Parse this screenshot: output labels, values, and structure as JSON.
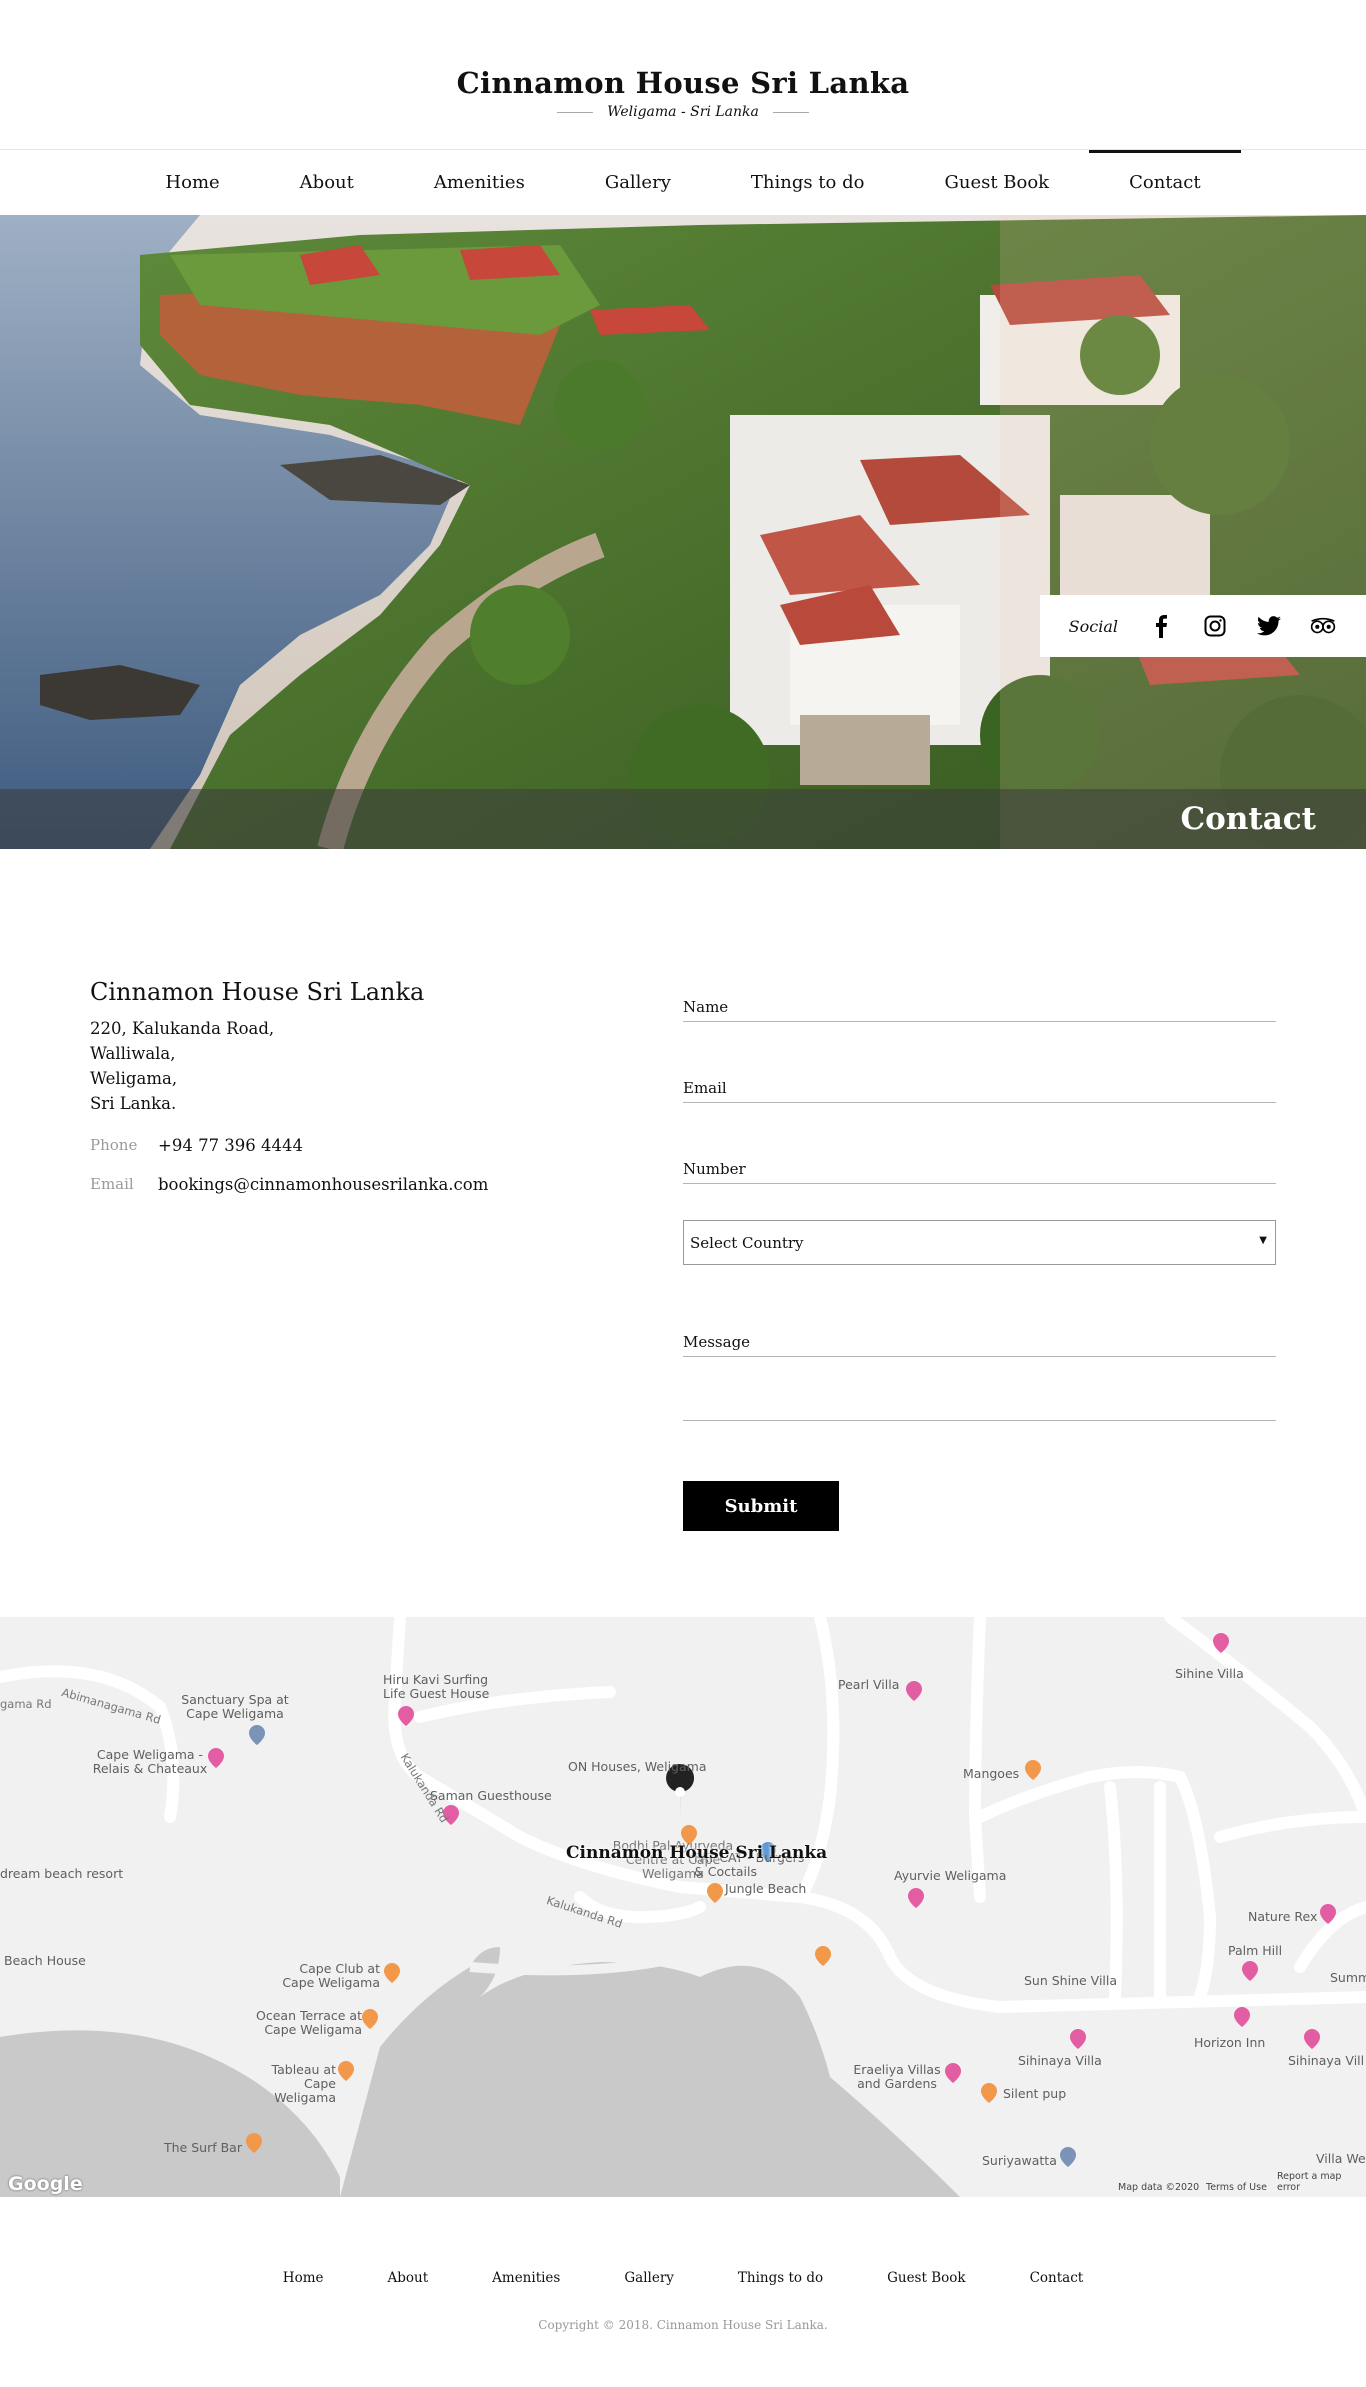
{
  "header": {
    "brand": "Cinnamon House Sri Lanka",
    "tagline": "Weligama - Sri Lanka"
  },
  "nav": {
    "items": [
      {
        "label": "Home"
      },
      {
        "label": "About"
      },
      {
        "label": "Amenities"
      },
      {
        "label": "Gallery"
      },
      {
        "label": "Things to do"
      },
      {
        "label": "Guest Book"
      },
      {
        "label": "Contact"
      }
    ],
    "active": "Contact"
  },
  "hero": {
    "title": "Contact",
    "social_label": "Social",
    "social_icons": [
      "facebook-icon",
      "instagram-icon",
      "twitter-icon",
      "tripadvisor-icon"
    ]
  },
  "address": {
    "name": "Cinnamon House Sri Lanka",
    "lines": [
      "220, Kalukanda Road,",
      "Walliwala,",
      "Weligama,",
      "Sri Lanka."
    ],
    "phone_label": "Phone",
    "phone": "+94 77 396 4444",
    "email_label": "Email",
    "email": "bookings@cinnamonhousesrilanka.com"
  },
  "form": {
    "name_label": "Name",
    "email_label": "Email",
    "number_label": "Number",
    "country_selected": "Select Country",
    "message_label": "Message",
    "submit_label": "Submit"
  },
  "map": {
    "title": "Cinnamon House Sri Lanka",
    "places": [
      "Sihine Villa",
      "Pearl Villa",
      "Hiru Kavi Surfing Life Guest House",
      "Sanctuary Spa at Cape Weligama",
      "Cape Weligama - Relais & Chateaux",
      "ON Houses, Weligama",
      "Saman Guesthouse",
      "Mangoes",
      "Bodhi Pal Ayurveda Centre at Cape Weligama",
      "FAT CAT - Burgers & Coctails",
      "Jungle Beach",
      "Ayurvie Weligama",
      "Nature Rex",
      "Palm Hill",
      "Sun Shine Villa",
      "Summ",
      "Horizon Inn",
      "Sihinaya Villa",
      "Sihinaya Vill",
      "Eraeliya Villas and Gardens",
      "Silent pup",
      "Suriyawatta",
      "Villa We",
      "Cape Club at Cape Weligama",
      "Ocean Terrace at Cape Weligama",
      "Tableau at Cape Weligama",
      "The Surf Bar",
      "dream beach resort",
      "Beach House"
    ],
    "roads": [
      "Kalukanda Rd",
      "Abimanagama Rd",
      "gama Rd"
    ],
    "google": "Google",
    "map_data": "Map data ©2020",
    "terms": "Terms of Use",
    "report": "Report a map error"
  },
  "footer": {
    "items": [
      "Home",
      "About",
      "Amenities",
      "Gallery",
      "Things to do",
      "Guest Book",
      "Contact"
    ],
    "copyright": "Copyright © 2018. Cinnamon House Sri Lanka."
  },
  "colors": {
    "accent": "#000000",
    "hotel_pin": "#e35da3",
    "food_pin": "#f1984a",
    "poi_pin": "#7a93b6"
  }
}
